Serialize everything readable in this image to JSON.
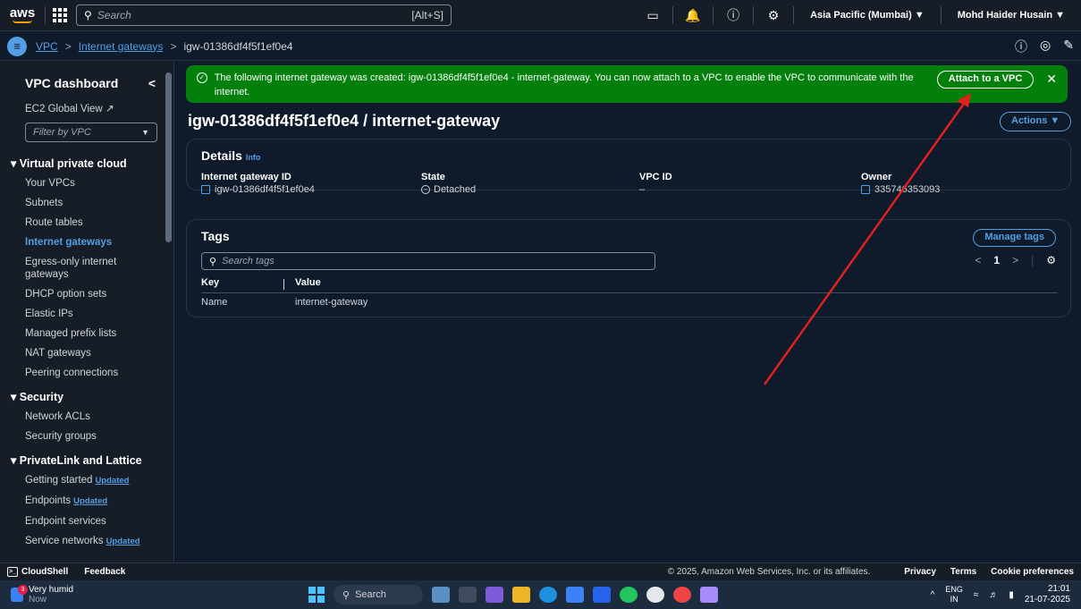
{
  "topnav": {
    "logo": "aws",
    "search_placeholder": "Search",
    "search_hint": "[Alt+S]",
    "region": "Asia Pacific (Mumbai) ▼",
    "user": "Mohd Haider Husain ▼",
    "icons": [
      "cloudshell-icon",
      "bell-icon",
      "help-icon",
      "gear-icon"
    ]
  },
  "breadcrumbs": {
    "items": [
      "VPC",
      "Internet gateways",
      "igw-01386df4f5f1ef0e4"
    ]
  },
  "sidebar": {
    "title": "VPC dashboard",
    "ec2_global_view": "EC2 Global View",
    "filter_placeholder": "Filter by VPC",
    "sections": [
      {
        "title": "Virtual private cloud",
        "items": [
          "Your VPCs",
          "Subnets",
          "Route tables",
          "Internet gateways",
          "Egress-only internet gateways",
          "DHCP option sets",
          "Elastic IPs",
          "Managed prefix lists",
          "NAT gateways",
          "Peering connections"
        ]
      },
      {
        "title": "Security",
        "items": [
          "Network ACLs",
          "Security groups"
        ]
      },
      {
        "title": "PrivateLink and Lattice",
        "items": [
          "Getting started",
          "Endpoints",
          "Endpoint services",
          "Service networks"
        ]
      }
    ],
    "active_item": "Internet gateways",
    "updated_badge": "Updated"
  },
  "flash": {
    "message": "The following internet gateway was created: igw-01386df4f5f1ef0e4 - internet-gateway. You can now attach to a VPC to enable the VPC to communicate with the internet.",
    "action": "Attach to a VPC",
    "color": "#037f0c"
  },
  "page": {
    "title": "igw-01386df4f5f1ef0e4 / internet-gateway",
    "actions": "Actions ▼"
  },
  "details": {
    "title": "Details",
    "info": "Info",
    "fields": [
      {
        "label": "Internet gateway ID",
        "value": "igw-01386df4f5f1ef0e4"
      },
      {
        "label": "State",
        "value": "Detached"
      },
      {
        "label": "VPC ID",
        "value": "–"
      },
      {
        "label": "Owner",
        "value": "335746353093"
      }
    ]
  },
  "tags": {
    "title": "Tags",
    "manage": "Manage tags",
    "search_placeholder": "Search tags",
    "page": "1",
    "columns": [
      "Key",
      "Value"
    ],
    "rows": [
      {
        "key": "Name",
        "value": "internet-gateway"
      }
    ]
  },
  "annotation": {
    "color": "#e02020"
  },
  "footer": {
    "cloudshell": "CloudShell",
    "feedback": "Feedback",
    "copyright": "© 2025, Amazon Web Services, Inc. or its affiliates.",
    "links": [
      "Privacy",
      "Terms",
      "Cookie preferences"
    ]
  },
  "taskbar": {
    "weather": "Very humid",
    "weather_sub": "Now",
    "weather_badge": "3",
    "search": "Search",
    "lang": "ENG",
    "lang_sub": "IN",
    "time": "21:01",
    "date": "21-07-2025"
  }
}
